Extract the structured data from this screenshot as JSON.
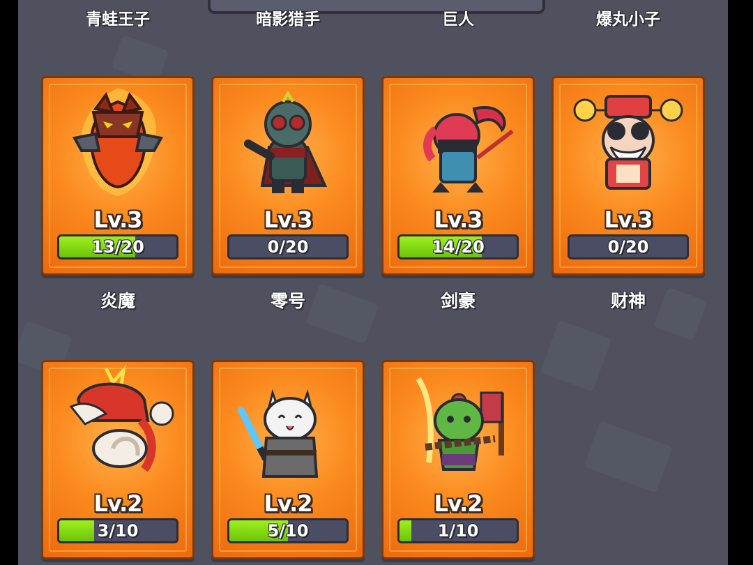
{
  "top_row_names": [
    "青蛙王子",
    "暗影猎手",
    "巨人",
    "爆丸小子"
  ],
  "heroes": [
    {
      "name": "炎魔",
      "level": "Lv.3",
      "progress": "13/20",
      "fill": 0.65,
      "icon": "flame-demon-icon"
    },
    {
      "name": "零号",
      "level": "Lv.3",
      "progress": "0/20",
      "fill": 0.0,
      "icon": "masked-rider-icon"
    },
    {
      "name": "剑豪",
      "level": "Lv.3",
      "progress": "14/20",
      "fill": 0.7,
      "icon": "swordsman-icon"
    },
    {
      "name": "财神",
      "level": "Lv.3",
      "progress": "0/20",
      "fill": 0.0,
      "icon": "fortune-god-icon"
    },
    {
      "name": "",
      "level": "Lv.2",
      "progress": "3/10",
      "fill": 0.3,
      "icon": "red-dragon-icon"
    },
    {
      "name": "",
      "level": "Lv.2",
      "progress": "5/10",
      "fill": 0.5,
      "icon": "cat-jedi-icon"
    },
    {
      "name": "",
      "level": "Lv.2",
      "progress": "1/10",
      "fill": 0.1,
      "icon": "orc-warrior-icon"
    }
  ],
  "colors": {
    "background": "#4f525e",
    "card_orange": "#fb8a1e",
    "progress_green": "#7ad510",
    "bar_track": "#4a4d63"
  }
}
